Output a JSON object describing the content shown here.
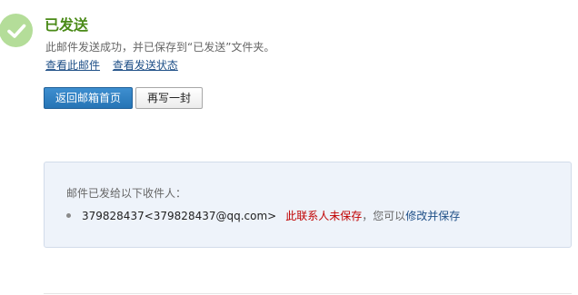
{
  "status": {
    "icon": "check-icon",
    "title": "已发送",
    "description": "此邮件发送成功，并已保存到“已发送”文件夹。",
    "links": {
      "view_mail": "查看此邮件",
      "view_status": "查看发送状态"
    }
  },
  "buttons": {
    "back_home": "返回邮箱首页",
    "write_another": "再写一封"
  },
  "recipients_panel": {
    "title": "邮件已发给以下收件人：",
    "items": [
      {
        "address": "379828437<379828437@qq.com>",
        "contact_status": "此联系人未保存",
        "hint": "，您可以",
        "action": "修改并保存"
      }
    ]
  },
  "colors": {
    "title_green": "#4a8a17",
    "check_bg": "#b4dd99",
    "link_blue": "#1e4f87",
    "primary_button": "#2674b5",
    "warning_red": "#c00000",
    "panel_bg": "#eef3fa"
  }
}
